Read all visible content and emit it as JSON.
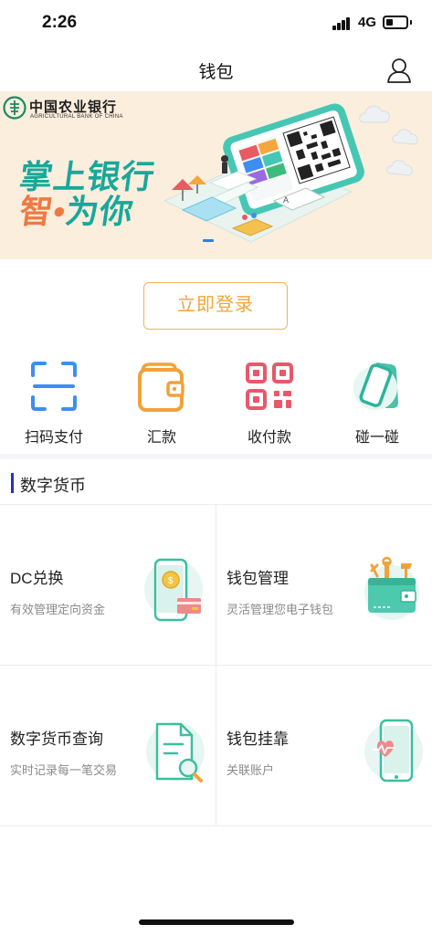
{
  "status_bar": {
    "time": "2:26",
    "network": "4G",
    "signal_bars": 4,
    "battery_level": 0.35
  },
  "nav": {
    "title": "钱包",
    "profile_icon": "user-icon"
  },
  "banner": {
    "bank_name": "中国农业银行",
    "bank_name_en": "AGRICULTURAL BANK OF CHINA",
    "slogan_line1": "掌上银行",
    "slogan_line2_a": "智",
    "slogan_line2_sep": "•",
    "slogan_line2_b": "为你",
    "background_color": "#fbeedd",
    "slogan_color": "#18a89a",
    "accent_color": "#ee7a43"
  },
  "login_button": {
    "label": "立即登录",
    "color": "#f0a63a"
  },
  "actions": [
    {
      "label": "扫码支付",
      "icon": "scan-icon",
      "color": "#3d8ef0"
    },
    {
      "label": "汇款",
      "icon": "wallet-icon",
      "color": "#f0a23a"
    },
    {
      "label": "收付款",
      "icon": "qrcode-icon",
      "color": "#e8586a"
    },
    {
      "label": "碰一碰",
      "icon": "phone-tap-icon",
      "color": "#2bb59b"
    }
  ],
  "section": {
    "title": "数字货币",
    "accent_color": "#2430c9"
  },
  "cards": [
    {
      "title": "DC兑换",
      "subtitle": "有效管理定向资金",
      "icon": "phone-coin-icon"
    },
    {
      "title": "钱包管理",
      "subtitle": "灵活管理您电子钱包",
      "icon": "wallet-tools-icon"
    },
    {
      "title": "数字货币查询",
      "subtitle": "实时记录每一笔交易",
      "icon": "document-search-icon"
    },
    {
      "title": "钱包挂靠",
      "subtitle": "关联账户",
      "icon": "phone-heart-icon"
    }
  ]
}
